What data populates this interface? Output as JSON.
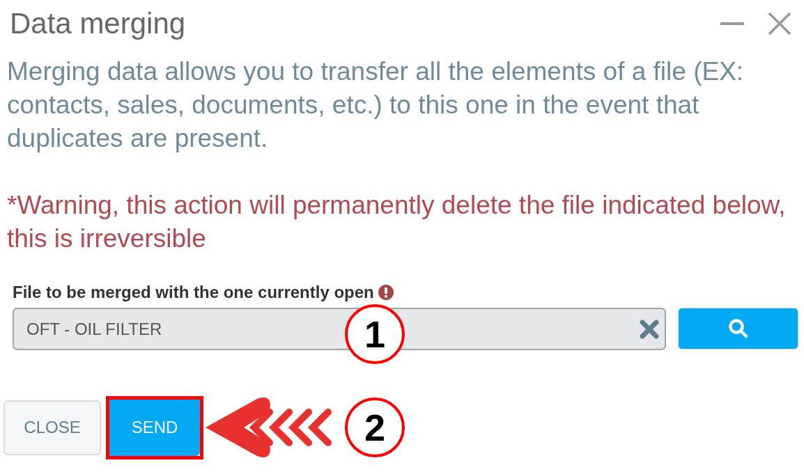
{
  "dialog": {
    "title": "Data merging",
    "description": "Merging data allows you to transfer all the elements of a file (EX: contacts, sales, documents, etc.) to this one in the event that duplicates are present.",
    "warning": "*Warning, this action will permanently delete the file indicated below, this is irreversible"
  },
  "merge_field": {
    "label": "File to be merged with the one currently open",
    "required": true,
    "value": "OFT - OIL FILTER"
  },
  "buttons": [
    {
      "label": "CLOSE",
      "kind": "secondary",
      "highlighted": false
    },
    {
      "label": "SEND",
      "kind": "primary",
      "highlighted": true
    }
  ],
  "annotations": [
    {
      "number": "1",
      "arrow": false
    },
    {
      "number": "2",
      "arrow": true
    }
  ]
}
